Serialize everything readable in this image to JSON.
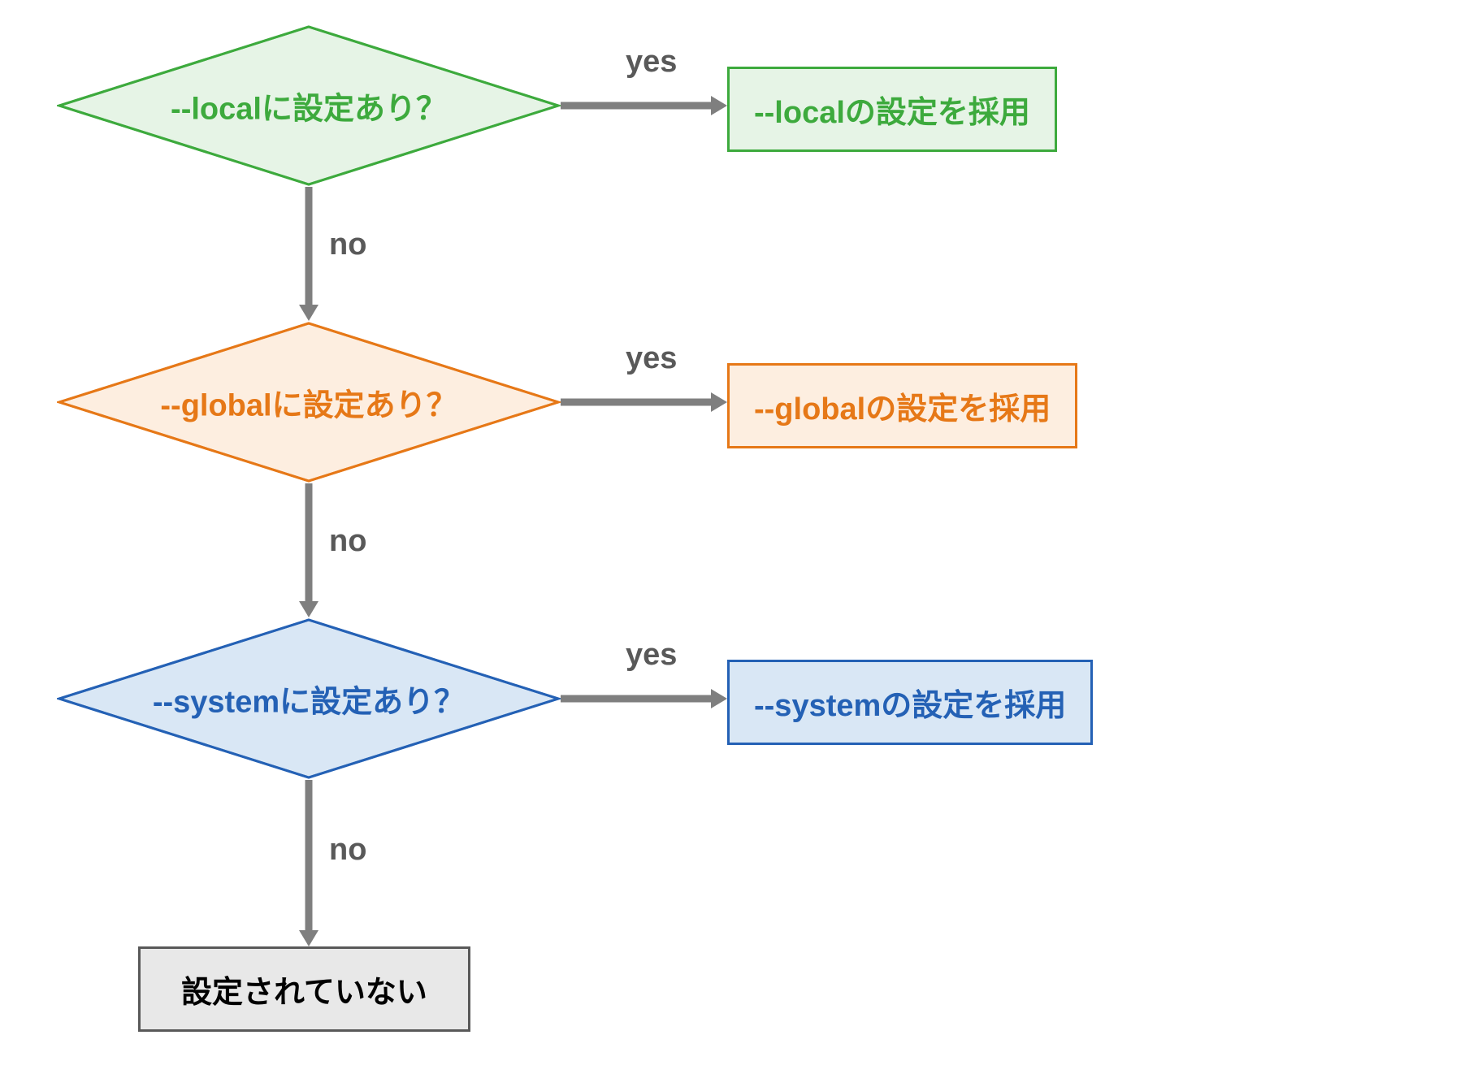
{
  "diamonds": {
    "local": {
      "flag": "--local",
      "suffix": "に設定あり？",
      "color": "#3daa3d",
      "fill": "#e6f4e6"
    },
    "global": {
      "flag": "--global",
      "suffix": "に設定あり？",
      "color": "#e67817",
      "fill": "#fdeee0"
    },
    "system": {
      "flag": "--system",
      "suffix": "に設定あり？",
      "color": "#2461b5",
      "fill": "#d9e7f5"
    }
  },
  "rects": {
    "local": {
      "flag": "--local",
      "suffix": "の設定を採用",
      "color": "#3daa3d",
      "fill": "#e6f4e6"
    },
    "global": {
      "flag": "--global",
      "suffix": "の設定を採用",
      "color": "#e67817",
      "fill": "#fdeee0"
    },
    "system": {
      "flag": "--system",
      "suffix": "の設定を採用",
      "color": "#2461b5",
      "fill": "#d9e7f5"
    }
  },
  "terminal": "設定されていない",
  "labels": {
    "yes": "yes",
    "no": "no"
  }
}
